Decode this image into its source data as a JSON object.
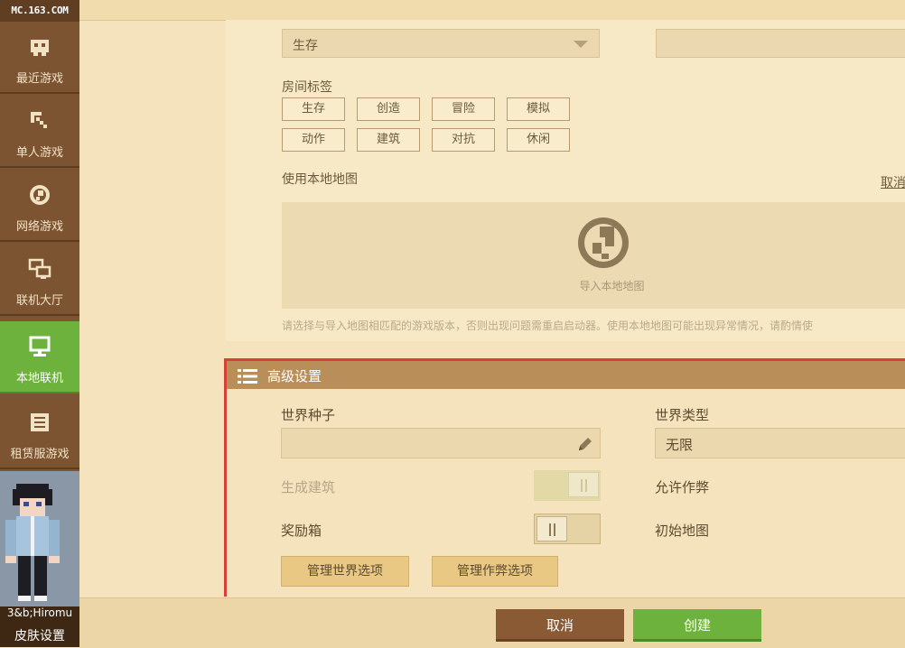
{
  "sidebar": {
    "logo": "MC.163.COM",
    "items": [
      {
        "label": "最近游戏",
        "icon": "gamepad-icon"
      },
      {
        "label": "单人游戏",
        "icon": "pickaxe-icon"
      },
      {
        "label": "网络游戏",
        "icon": "globe-icon"
      },
      {
        "label": "联机大厅",
        "icon": "lan-icon"
      },
      {
        "label": "本地联机",
        "icon": "monitor-icon",
        "active": true
      },
      {
        "label": "租赁服游戏",
        "icon": "server-list-icon"
      }
    ],
    "username": "3&b;Hiromu",
    "skin_label": "皮肤设置"
  },
  "form": {
    "mode_select_value": "生存",
    "room_tags_label": "房间标签",
    "tags": [
      "生存",
      "创造",
      "冒险",
      "模拟",
      "动作",
      "建筑",
      "对抗",
      "休闲"
    ],
    "local_map_label": "使用本地地图",
    "cancel_link": "取消",
    "import_label": "导入本地地图",
    "hint": "请选择与导入地图相匹配的游戏版本，否则出现问题需重启启动器。使用本地地图可能出现异常情况，请酌情使"
  },
  "advanced": {
    "title": "高级设置",
    "seed_label": "世界种子",
    "seed_value": "",
    "world_type_label": "世界类型",
    "world_type_value": "无限",
    "generate_structures_label": "生成建筑",
    "generate_structures_enabled": false,
    "generate_structures_disabled": true,
    "allow_cheats_label": "允许作弊",
    "bonus_chest_label": "奖励箱",
    "bonus_chest_enabled": false,
    "starting_map_label": "初始地图",
    "manage_world_options": "管理世界选项",
    "manage_cheat_options": "管理作弊选项"
  },
  "footer": {
    "cancel_button": "取消",
    "create_button": "创建"
  },
  "colors": {
    "accent_green": "#6cb23c",
    "sidebar_brown": "#7c5432",
    "highlight_red": "#d64036",
    "header_tan": "#b98e59"
  }
}
